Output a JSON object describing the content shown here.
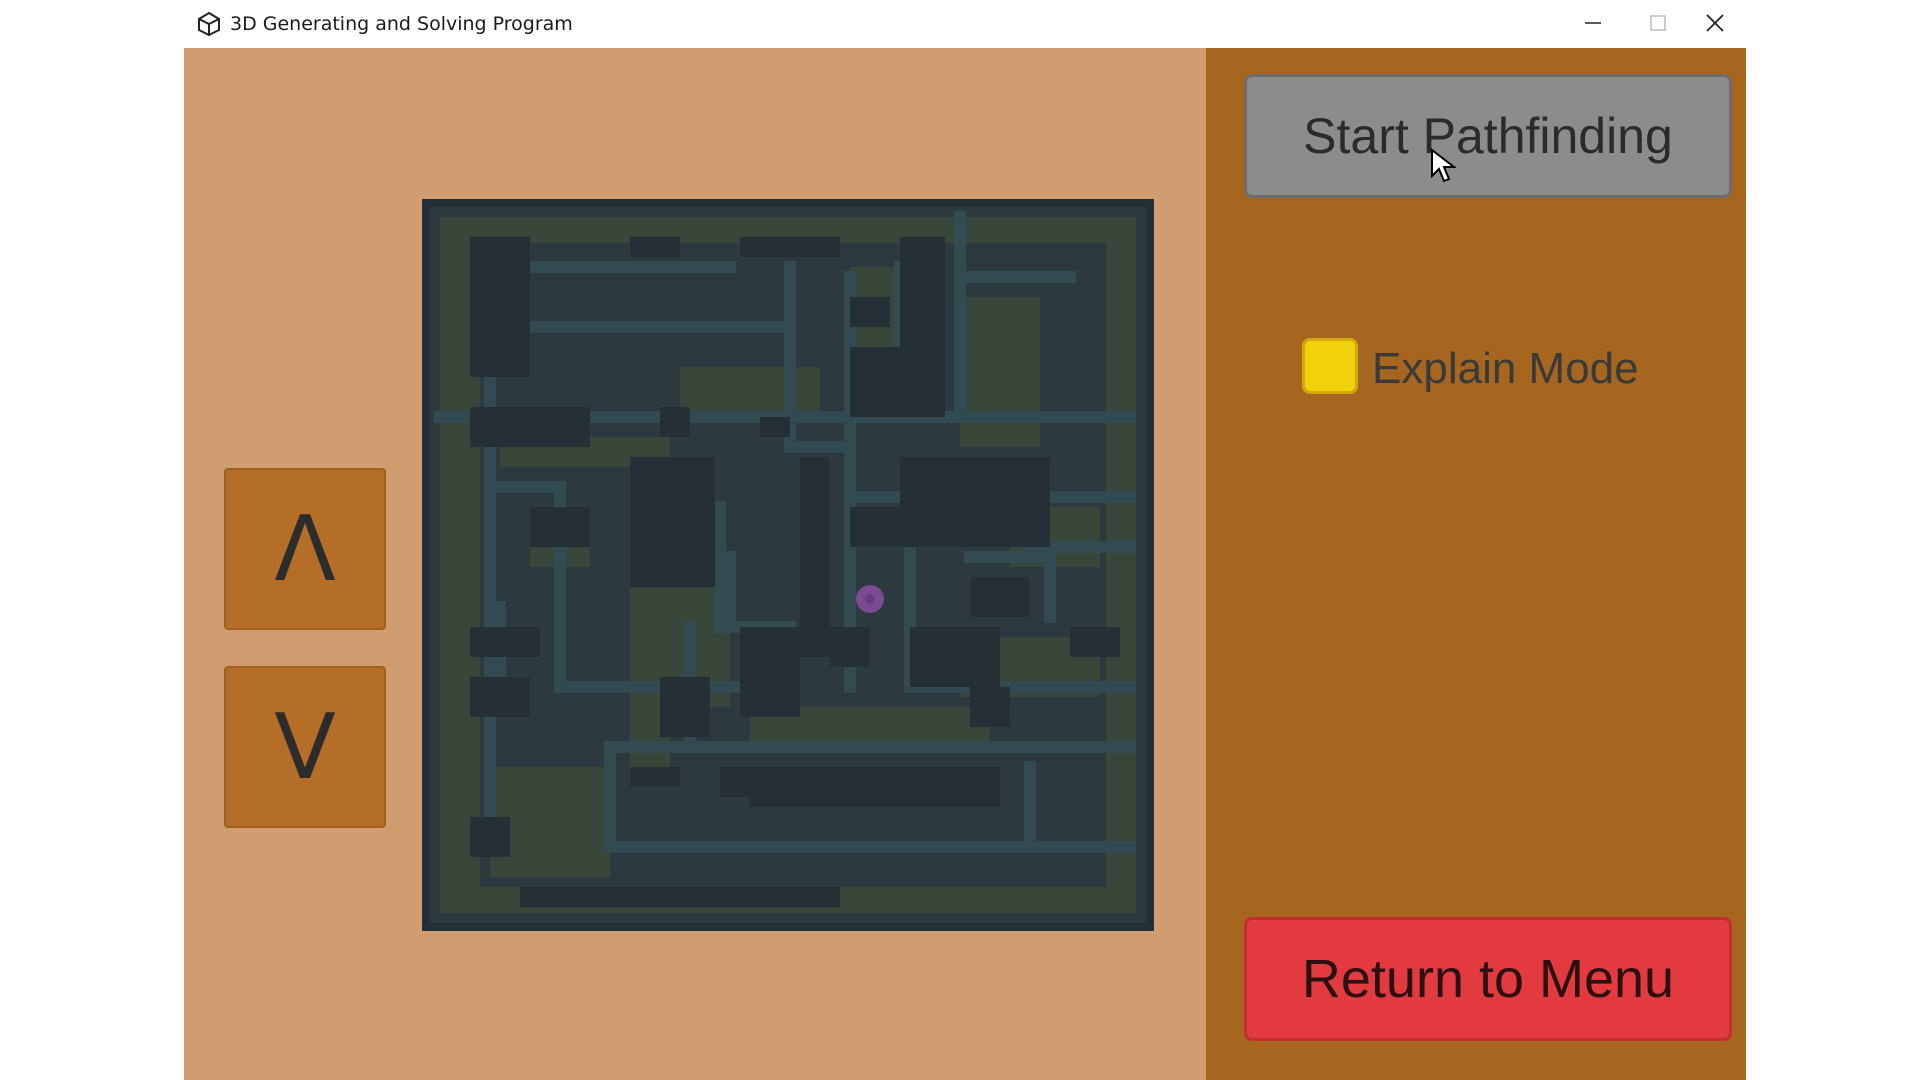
{
  "window": {
    "title": "3D Generating and Solving Program",
    "icon": "unity-logo-icon",
    "controls": [
      "minimize-icon",
      "maximize-icon",
      "close-icon"
    ]
  },
  "controls": {
    "up_label": "Λ",
    "down_label": "V"
  },
  "right_panel": {
    "start_label": "Start Pathfinding",
    "explain_label": "Explain Mode",
    "explain_checked": true,
    "return_label": "Return to Menu"
  },
  "colors": {
    "left_panel": "#cf9d6f",
    "right_panel": "#a7661f",
    "arrow_button": "#b46e28",
    "start_button": "#8d8c8b",
    "explain_checkbox": "#f2d20d",
    "return_button": "#e23a3f",
    "maze_wall": "#2c3a40",
    "maze_floor": "#3e4a3a",
    "player_marker": "#8a4fa0"
  }
}
